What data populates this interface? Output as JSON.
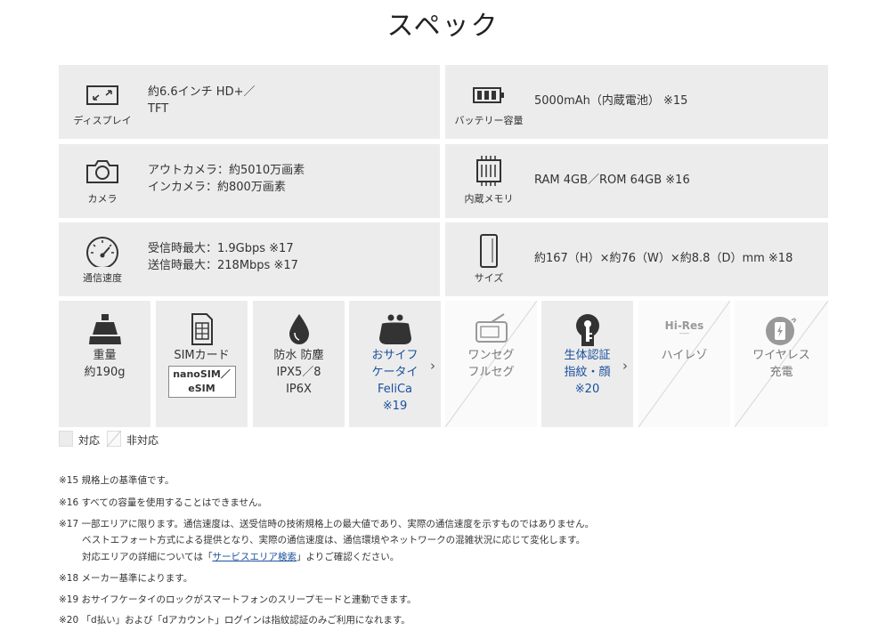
{
  "page": {
    "title": "スペック"
  },
  "specs": {
    "display": {
      "label": "ディスプレイ",
      "line1": "約6.6インチ HD+／",
      "line2": "TFT"
    },
    "battery": {
      "label": "バッテリー容量",
      "value": "5000mAh（内蔵電池） ※15"
    },
    "camera": {
      "label": "カメラ",
      "line1": "アウトカメラ：約5010万画素",
      "line2": "インカメラ：約800万画素"
    },
    "memory": {
      "label": "内蔵メモリ",
      "value": "RAM 4GB／ROM 64GB ※16"
    },
    "speed": {
      "label": "通信速度",
      "line1": "受信時最大：1.9Gbps ※17",
      "line2": "送信時最大：218Mbps ※17"
    },
    "size": {
      "label": "サイズ",
      "value": "約167（H）×約76（W）×約8.8（D）mm ※18"
    }
  },
  "features": {
    "weight": {
      "line1": "重量",
      "line2": "約190g",
      "icon": "weight-icon",
      "supported": true
    },
    "sim": {
      "line1": "SIMカード",
      "box1": "nanoSIM／",
      "box2": "eSIM",
      "icon": "sim-card-icon",
      "supported": true
    },
    "water": {
      "line1": "防水 防塵",
      "line2": "IPX5／8",
      "line3": "IP6X",
      "icon": "water-drop-icon",
      "supported": true
    },
    "osaifu": {
      "line1": "おサイフ",
      "line2": "ケータイ",
      "line3": "FeliCa",
      "line4": "※19",
      "icon": "purse-icon",
      "supported": true,
      "chevron": "›"
    },
    "oneseg": {
      "line1": "ワンセグ",
      "line2": "フルセグ",
      "icon": "tv-icon",
      "supported": false
    },
    "bio": {
      "line1": "生体認証",
      "line2": "指紋・顔",
      "line3": "※20",
      "icon": "keyhole-icon",
      "supported": true,
      "chevron": "›"
    },
    "hires": {
      "line1": "ハイレゾ",
      "logo": "Hi-Res",
      "icon": "hi-res-icon",
      "supported": false
    },
    "wireless": {
      "line1": "ワイヤレス",
      "line2": "充電",
      "icon": "wireless-charging-icon",
      "supported": false
    }
  },
  "legend": {
    "on": "対応",
    "off": "非対応"
  },
  "notes": {
    "n15": "※15 規格上の基準値です。",
    "n16": "※16 すべての容量を使用することはできません。",
    "n17a": "※17 一部エリアに限ります。通信速度は、送受信時の技術規格上の最大値であり、実際の通信速度を示すものではありません。",
    "n17b": "ベストエフォート方式による提供となり、実際の通信速度は、通信環境やネットワークの混雑状況に応じて変化します。",
    "n17c_pre": "対応エリアの詳細については「",
    "n17c_link": "サービスエリア検索",
    "n17c_post": "」よりご確認ください。",
    "n18": "※18 メーカー基準によります。",
    "n19": "※19 おサイフケータイのロックがスマートフォンのスリープモードと連動できます。",
    "n20": "※20 「d払い」および「dアカウント」ログインは指紋認証のみご利用になれます。"
  },
  "colors": {
    "box_bg": "#ececec",
    "off_bg": "#fafafa",
    "link": "#1a4f9c"
  }
}
